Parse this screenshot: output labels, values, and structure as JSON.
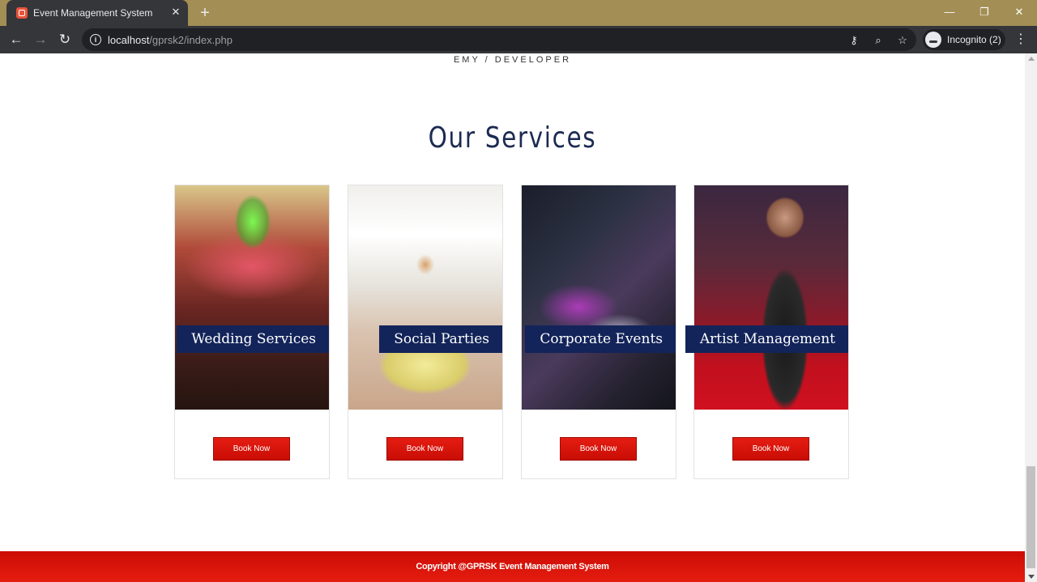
{
  "browser": {
    "tab_title": "Event Management System",
    "tab_close": "✕",
    "new_tab": "+",
    "url_host": "localhost",
    "url_path": "/gprsk2/index.php",
    "incognito_label": "Incognito (2)",
    "win_minimize": "—",
    "win_restore": "❐",
    "win_close": "✕",
    "back": "←",
    "forward": "→",
    "reload": "↻",
    "key_icon": "⚷",
    "zoom_icon": "⌕",
    "star_icon": "☆",
    "menu": "⋮"
  },
  "page": {
    "tagline": "EMY / DEVELOPER",
    "section_title": "Our Services",
    "services": [
      {
        "label": "Wedding Services",
        "button": "Book Now"
      },
      {
        "label": "Social Parties",
        "button": "Book Now"
      },
      {
        "label": "Corporate Events",
        "button": "Book Now"
      },
      {
        "label": "Artist Management",
        "button": "Book Now"
      }
    ],
    "footer_text": "Copyright @GPRSK Event Management System"
  },
  "colors": {
    "navy": "#13245a",
    "title": "#1c2b52",
    "red": "#e51d12"
  }
}
